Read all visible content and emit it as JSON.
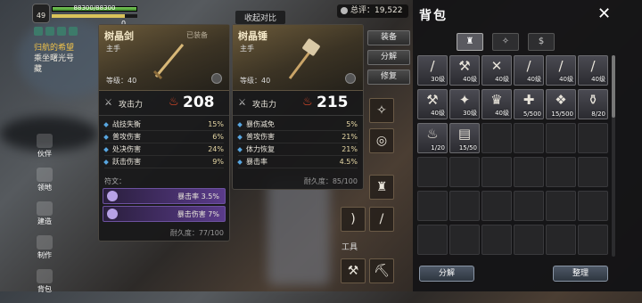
{
  "hud": {
    "level": "49",
    "hp_text": "88300/88300",
    "hp_fraction": 1.0,
    "stamina_fraction": 0.85,
    "stat_a": "",
    "stat_b": "0"
  },
  "quest": {
    "line1": "归航的希望",
    "line2": "乘坐曙光号",
    "line3": "藏"
  },
  "side_nav": [
    {
      "label": "伙伴"
    },
    {
      "label": "领地"
    },
    {
      "label": "建造"
    },
    {
      "label": "制作"
    },
    {
      "label": "背包"
    }
  ],
  "card1": {
    "name": "树晶剑",
    "equipped": "已装备",
    "slot": "主手",
    "level": "等级：40",
    "atk_label": "攻击力",
    "atk_value": "208",
    "stats": [
      {
        "name": "战技失衡",
        "val": "15%"
      },
      {
        "name": "普攻伤害",
        "val": "6%"
      },
      {
        "name": "处决伤害",
        "val": "24%"
      },
      {
        "name": "跃击伤害",
        "val": "9%"
      }
    ],
    "runes_label": "符文：",
    "runes": [
      {
        "text": "暴击率 3.5%"
      },
      {
        "text": "暴击伤害 7%"
      }
    ],
    "durability": "耐久度：77/100"
  },
  "card2": {
    "name": "树晶锤",
    "slot": "主手",
    "level": "等级：40",
    "atk_label": "攻击力",
    "atk_value": "215",
    "stats": [
      {
        "name": "暴伤减免",
        "val": "5%"
      },
      {
        "name": "普攻伤害",
        "val": "21%"
      },
      {
        "name": "体力恢复",
        "val": "21%"
      },
      {
        "name": "暴击率",
        "val": "4.5%"
      }
    ],
    "durability": "耐久度：85/100"
  },
  "collapse_label": "收起对比",
  "score": "总评：19,522",
  "menu": {
    "equip": "装备",
    "split": "分解",
    "repair": "修复"
  },
  "tools_label": "工具",
  "bag": {
    "title": "背包",
    "close": "✕",
    "tabs": [
      {
        "icon": "armor-icon",
        "glyph": "♜"
      },
      {
        "icon": "compass-icon",
        "glyph": "✧"
      },
      {
        "icon": "coin-icon",
        "glyph": "$"
      }
    ],
    "items": [
      {
        "glyph": "/",
        "lv": "30级"
      },
      {
        "glyph": "⚒",
        "lv": "40级"
      },
      {
        "glyph": "✕",
        "lv": "40级"
      },
      {
        "glyph": "/",
        "lv": "40级"
      },
      {
        "glyph": "/",
        "lv": "40级"
      },
      {
        "glyph": "/",
        "lv": "40级"
      },
      {
        "glyph": "⚒",
        "lv": "40级"
      },
      {
        "glyph": "✦",
        "lv": "30级"
      },
      {
        "glyph": "♛",
        "lv": "40级"
      },
      {
        "glyph": "✚",
        "lv": "5/500"
      },
      {
        "glyph": "❖",
        "lv": "15/500"
      },
      {
        "glyph": "⚱",
        "lv": "8/20"
      },
      {
        "glyph": "♨",
        "lv": "1/20"
      },
      {
        "glyph": "▤",
        "lv": "15/50"
      }
    ],
    "total_cells": 36,
    "split_label": "分解",
    "sort_label": "整理"
  }
}
